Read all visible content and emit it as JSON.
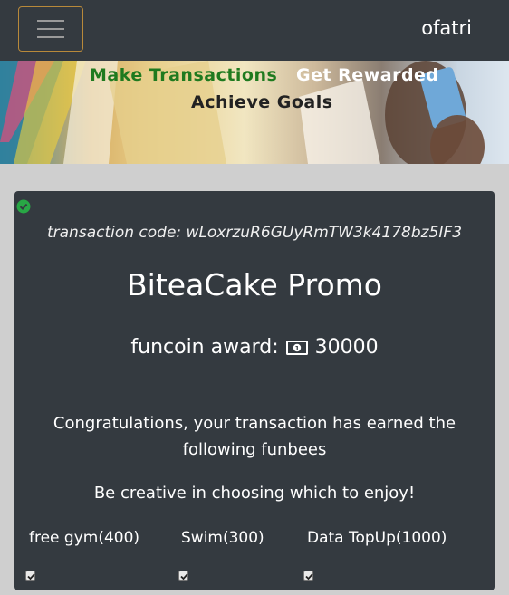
{
  "navbar": {
    "brand": "ofatri",
    "toggle_icon": "hamburger-icon",
    "toggle_border_color": "#b8893a"
  },
  "banner": {
    "tagline_1": "Make Transactions",
    "tagline_2": "Get Rewarded",
    "tagline_3": "Achieve Goals"
  },
  "card": {
    "status_icon": "check-circle-icon",
    "transaction_code": "transaction code: wLoxrzuR6GUyRmTW3k4178bz5IF3",
    "title": "BiteaCake Promo",
    "award_label": "funcoin award:",
    "award_icon": "money-icon",
    "award_value": "30000",
    "congrats_text": "Congratulations, your transaction has earned the following funbees",
    "creative_text": "Be creative in choosing which to enjoy!",
    "options": [
      {
        "label": "free gym(400)",
        "checked": true
      },
      {
        "label": "Swim(300)",
        "checked": true
      },
      {
        "label": "Data TopUp(1000)",
        "checked": true
      }
    ]
  },
  "colors": {
    "nav_bg": "#343a40",
    "card_bg": "#343a40",
    "page_bg": "#cfcfcf",
    "tagline_green": "#1f7a1f",
    "check_green": "#28a745"
  }
}
